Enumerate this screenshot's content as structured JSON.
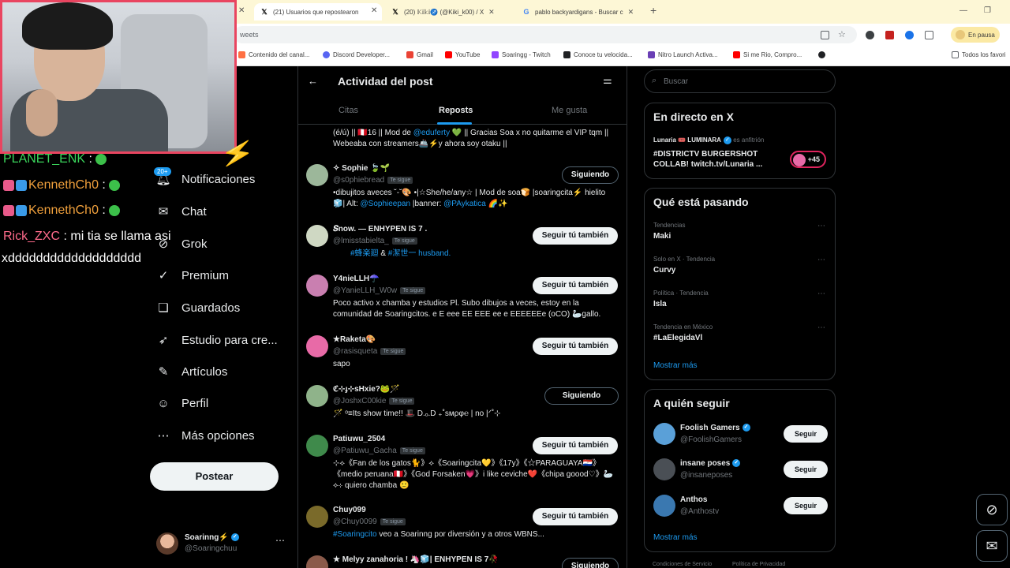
{
  "browser": {
    "tabs": [
      {
        "title": "(21) Usuarios que repostearon",
        "icon": "X",
        "active": true
      },
      {
        "title": "(20) 𝕂𝕚𝕜𝕚♐ (@Kiki_k00) / X",
        "icon": "X",
        "active": false
      },
      {
        "title": "pablo backyardigans - Buscar c",
        "icon": "G",
        "active": false
      }
    ],
    "address_fragment": "weets",
    "paused_label": "En pausa",
    "bookmarks": [
      "Contenido del canal...",
      "Discord Developer...",
      "Gmail",
      "YouTube",
      "Soaringg - Twitch",
      "Conoce tu velocida...",
      "Nitro Launch Activa...",
      "Si me Rio, Compro..."
    ],
    "bookmarks_other": "Todos los favori"
  },
  "chat": [
    {
      "user": "PLANET_ENK",
      "text": "",
      "color": "#3ad55b"
    },
    {
      "user": "KennethCh0",
      "text": "",
      "color": "#f0a03c"
    },
    {
      "user": "KennethCh0",
      "text": "",
      "color": "#f0a03c"
    },
    {
      "user": "Rick_ZXC",
      "text": "mi tia se llama asi",
      "color": "#ff6b8b"
    },
    {
      "user": "",
      "text": "xddddddddddddddddddd",
      "color": "#ffffff"
    }
  ],
  "nav": {
    "badge": "20+",
    "items": [
      "Notificaciones",
      "Chat",
      "Grok",
      "Premium",
      "Guardados",
      "Estudio para cre...",
      "Artículos",
      "Perfil",
      "Más opciones"
    ],
    "post_label": "Postear",
    "account_name": "Soarinng⚡",
    "account_handle": "@Soaringchuu"
  },
  "main": {
    "title": "Actividad del post",
    "tabs": [
      "Citas",
      "Reposts",
      "Me gusta"
    ],
    "top_bio": {
      "before": "(é/ú) || 🇵🇪16 || Mod de ",
      "link": "@eduferty",
      "after": " 💚 || Gracias Soa x no quitarme el VIP tqm || Webeaba con streamers🚢⚡y ahora soy otaku ||"
    },
    "users": [
      {
        "name": "✧ Sophie 🍃🌱",
        "handle": "@s0phiebread",
        "btn": "Siguiendo",
        "bio": "•dibujitos aveces ˘-˘🎨 •|☆She/he/any☆ | Mod de soa🍞 |soaringcita⚡ hielito🧊| Alt: ",
        "bio_link": "@Sophieepan",
        "bio_mid": " |banner: ",
        "bio_link2": "@PAykatica",
        "bio_end": " 🌈✨"
      },
      {
        "name": "𝑺now. — ENHYPEN IS 7 .",
        "handle": "@lmisstabielta_",
        "btn": "Seguir tú también",
        "bio": "",
        "bio_link": "#蜂楽廻",
        "bio_mid": " & ",
        "bio_link2": "#潔世一 husband.",
        "bio_end": ""
      },
      {
        "name": "Y4nieLLH☂️",
        "handle": "@YanieLLH_W0w",
        "btn": "Seguir tú también",
        "bio": "Poco activo x chamba y estudios Pl. Subo dibujos a veces, estoy en la comunidad de Soaringcitos. e E eee EE EEE ee e EEEEEEe (oCO) 🦢gallo.",
        "bio_link": "",
        "bio_mid": "",
        "bio_link2": "",
        "bio_end": ""
      },
      {
        "name": "★Raketa🎨",
        "handle": "@rasisqueta",
        "btn": "Seguir tú también",
        "bio": "sapo",
        "bio_link": "",
        "bio_mid": "",
        "bio_link2": "",
        "bio_end": ""
      },
      {
        "name": "ℭ⊹ɟ⊹sHxie?🐸🪄",
        "handle": "@JoshxC00kie",
        "btn": "Siguiendo",
        "bio": "🪄 ᵒ≡Its shᴏᴡ time!! 🎩 D.ₒ.D ₊˚ѕмρφ℮ | no |ᐟ˚⊹",
        "bio_link": "",
        "bio_mid": "",
        "bio_link2": "",
        "bio_end": ""
      },
      {
        "name": "Patiuwu_2504",
        "handle": "@Patiuwu_Gacha",
        "btn": "Seguir tú también",
        "bio": "⊹⟡《Fan de los gatos🐈》⟡《Soaringcita💛》《17y》《☆PARAGUAYA🇵🇾》《medio peruana🇵🇪》《God Forsaken💗》i like ceviche❤️《chipa goood♡》🦢⟡⊹ quiero chamba 🙂",
        "bio_link": "",
        "bio_mid": "",
        "bio_link2": "",
        "bio_end": ""
      },
      {
        "name": "Chuy099",
        "handle": "@Chuy0099",
        "btn": "Seguir tú también",
        "bio": "",
        "bio_link": "#Soaringcito",
        "bio_mid": " veo a Soarinng por diversión y a otros WBNS...",
        "bio_link2": "",
        "bio_end": ""
      },
      {
        "name": "★ Melyy zanahoria ! 🦄🧊| ENHYPEN IS 7🥀",
        "handle": "",
        "btn": "Siguiendo",
        "bio": "",
        "bio_link": "",
        "bio_mid": "",
        "bio_link2": "",
        "bio_end": ""
      }
    ],
    "follows_you": "Te sigue"
  },
  "right": {
    "search_placeholder": "Buscar",
    "live": {
      "title": "En directo en X",
      "host": "Lunaria 🎟️ LUMINARA",
      "host_suffix": "es anfitrión",
      "text": "#DISTRICTV BURGERSHOT COLLAB! twitch.tv/Lunaria ...",
      "count": "+45"
    },
    "trends": {
      "title": "Qué está pasando",
      "items": [
        {
          "context": "Tendencias",
          "name": "Maki"
        },
        {
          "context": "Solo en X · Tendencia",
          "name": "Curvy"
        },
        {
          "context": "Política · Tendencia",
          "name": "Isla"
        },
        {
          "context": "Tendencia en México",
          "name": "#LaElegidaVl"
        }
      ],
      "more": "Mostrar más"
    },
    "follow": {
      "title": "A quién seguir",
      "items": [
        {
          "name": "Foolish Gamers",
          "handle": "@FoolishGamers",
          "btn": "Seguir"
        },
        {
          "name": "insane poses",
          "handle": "@insaneposes",
          "btn": "Seguir"
        },
        {
          "name": "Anthos",
          "handle": "@Anthostv",
          "btn": "Seguir"
        }
      ],
      "more": "Mostrar más"
    },
    "footer": [
      "Condiciones de Servicio",
      "Política de Privacidad"
    ]
  }
}
